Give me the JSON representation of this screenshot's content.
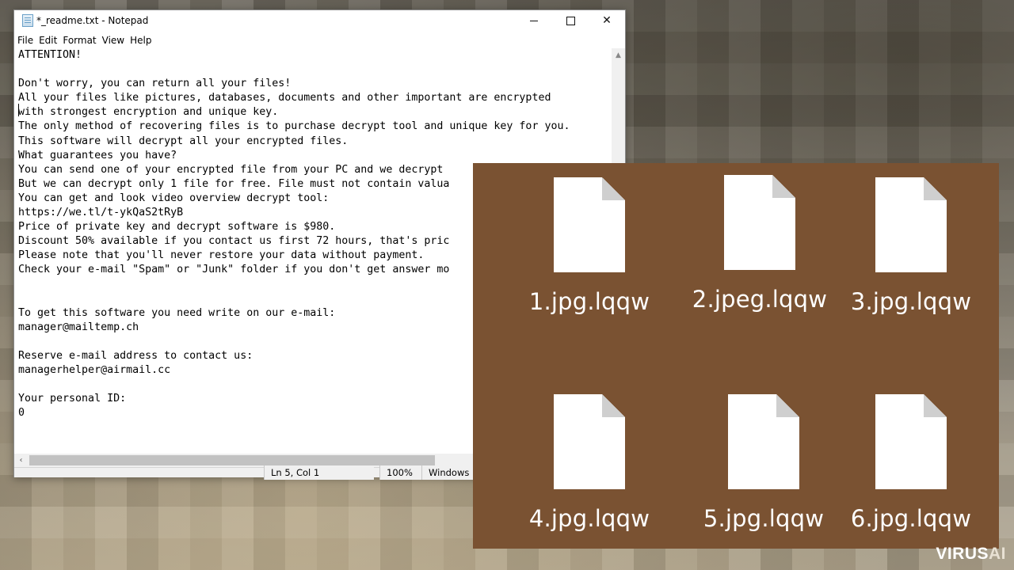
{
  "window": {
    "title": "*_readme.txt - Notepad",
    "menu": [
      "File",
      "Edit",
      "Format",
      "View",
      "Help"
    ],
    "controls": {
      "minimize": "minimize",
      "maximize": "maximize",
      "close": "✕"
    }
  },
  "editor": {
    "text": "ATTENTION!\n\nDon't worry, you can return all your files!\nAll your files like pictures, databases, documents and other important are encrypted\nwith strongest encryption and unique key.\nThe only method of recovering files is to purchase decrypt tool and unique key for you.\nThis software will decrypt all your encrypted files.\nWhat guarantees you have?\nYou can send one of your encrypted file from your PC and we decrypt\nBut we can decrypt only 1 file for free. File must not contain valua\nYou can get and look video overview decrypt tool:\nhttps://we.tl/t-ykQaS2tRyB\nPrice of private key and decrypt software is $980.\nDiscount 50% available if you contact us first 72 hours, that's pric\nPlease note that you'll never restore your data without payment.\nCheck your e-mail \"Spam\" or \"Junk\" folder if you don't get answer mo\n\n\nTo get this software you need write on our e-mail:\nmanager@mailtemp.ch\n\nReserve e-mail address to contact us:\nmanagerhelper@airmail.cc\n\nYour personal ID:\n0"
  },
  "statusbar": {
    "position": "Ln 5, Col 1",
    "zoom": "100%",
    "line_ending": "Windows"
  },
  "files": [
    {
      "name": "1.jpg.lqqw",
      "icon": "blank-document-icon"
    },
    {
      "name": "2.jpeg.lqqw",
      "icon": "blank-document-icon"
    },
    {
      "name": "3.jpg.lqqw",
      "icon": "blank-document-icon"
    },
    {
      "name": "4.jpg.lqqw",
      "icon": "blank-document-icon"
    },
    {
      "name": "5.jpg.lqqw",
      "icon": "blank-document-icon"
    },
    {
      "name": "6.jpg.lqqw",
      "icon": "blank-document-icon"
    }
  ],
  "watermark": {
    "part1": "VIRUS",
    "part2": "AI"
  },
  "colors": {
    "files_background": "#7a5232",
    "notepad_background": "#ffffff"
  }
}
